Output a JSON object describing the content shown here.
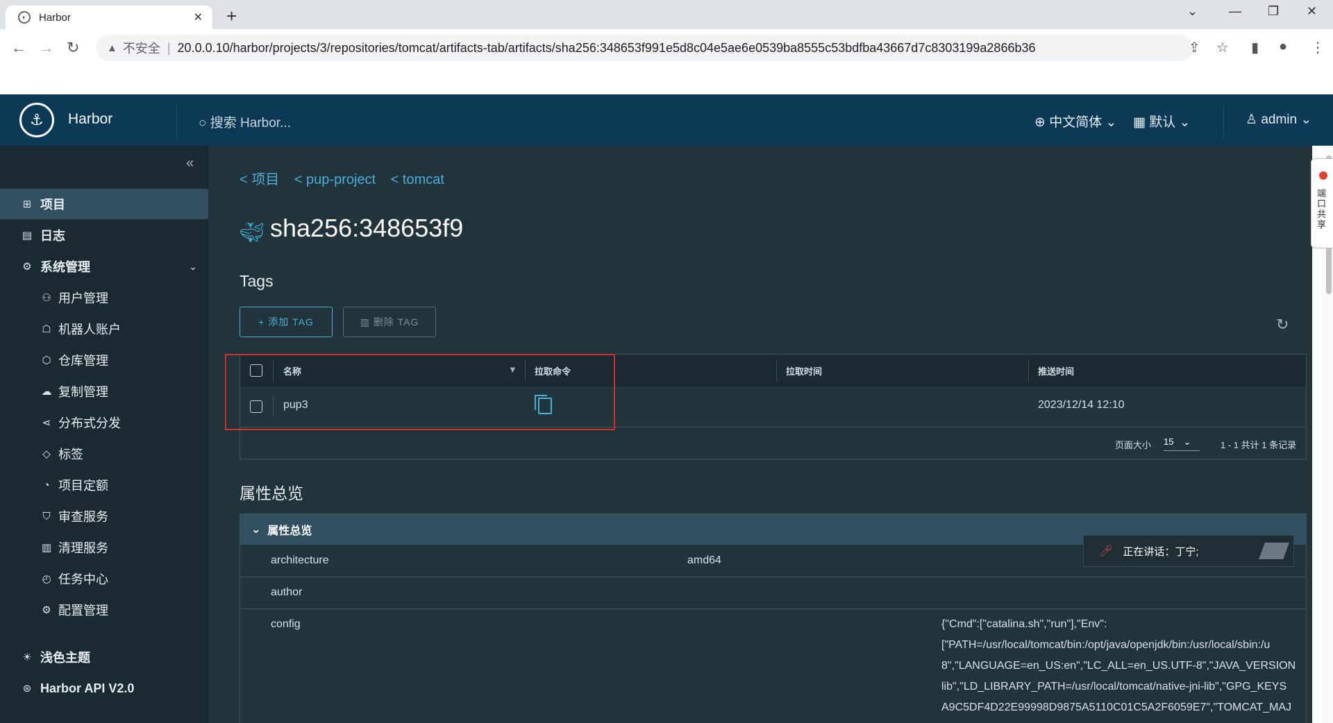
{
  "browser": {
    "tab_title": "Harbor",
    "tab_close": "✕",
    "new_tab": "+",
    "insecure_label": "不安全",
    "url": "20.0.0.10/harbor/projects/3/repositories/tomcat/artifacts-tab/artifacts/sha256:348653f991e5d8c04e5ae6e0539ba8555c53bdfba43667d7c8303199a2866b36"
  },
  "header": {
    "brand": "Harbor",
    "search_placeholder": "搜索 Harbor...",
    "language": "中文简体",
    "theme_default": "默认",
    "user": "admin"
  },
  "sidebar": {
    "items": [
      {
        "label": "项目",
        "icon": "projects-icon"
      },
      {
        "label": "日志",
        "icon": "logs-icon"
      },
      {
        "label": "系统管理",
        "icon": "admin-icon"
      },
      {
        "label": "用户管理",
        "icon": "users-icon"
      },
      {
        "label": "机器人账户",
        "icon": "robot-icon"
      },
      {
        "label": "仓库管理",
        "icon": "registry-icon"
      },
      {
        "label": "复制管理",
        "icon": "replication-icon"
      },
      {
        "label": "分布式分发",
        "icon": "distribution-icon"
      },
      {
        "label": "标签",
        "icon": "tag-icon"
      },
      {
        "label": "项目定额",
        "icon": "quota-icon"
      },
      {
        "label": "审查服务",
        "icon": "shield-icon"
      },
      {
        "label": "清理服务",
        "icon": "trash-icon"
      },
      {
        "label": "任务中心",
        "icon": "gauge-icon"
      },
      {
        "label": "配置管理",
        "icon": "gear-icon"
      }
    ],
    "light_theme": "浅色主题",
    "api": "Harbor API V2.0"
  },
  "breadcrumb": {
    "items": [
      "< 项目",
      "< pup-project",
      "< tomcat"
    ]
  },
  "artifact": {
    "digest": "sha256:348653f9"
  },
  "tags": {
    "heading": "Tags",
    "add_label": "+ 添加 TAG",
    "delete_label": "删除 TAG",
    "columns": [
      "名称",
      "拉取命令",
      "拉取时间",
      "推送时间"
    ],
    "rows": [
      {
        "name": "pup3",
        "pull_time": "",
        "push_time": "2023/12/14 12:10"
      }
    ],
    "page_size_label": "页面大小",
    "page_size": "15",
    "summary": "1 - 1 共计 1 条记录"
  },
  "attributes": {
    "heading": "属性总览",
    "panel_title": "属性总览",
    "rows": [
      {
        "key": "architecture",
        "value": "amd64"
      },
      {
        "key": "author",
        "value": ""
      },
      {
        "key": "config",
        "value": ""
      }
    ],
    "config_lines": [
      "{\"Cmd\":[\"catalina.sh\",\"run\"],\"Env\":",
      "[\"PATH=/usr/local/tomcat/bin:/opt/java/openjdk/bin:/usr/local/sbin:/u",
      "8\",\"LANGUAGE=en_US:en\",\"LC_ALL=en_US.UTF-8\",\"JAVA_VERSION",
      "lib\",\"LD_LIBRARY_PATH=/usr/local/tomcat/native-jni-lib\",\"GPG_KEYS",
      "A9C5DF4D22E99998D9875A5110C01C5A2F6059E7\",\"TOMCAT_MAJ"
    ]
  },
  "toast": {
    "text": "正在讲话：丁宁;"
  },
  "float_panel": {
    "text": "端口共享"
  },
  "colors": {
    "header_bg": "#0b3956",
    "sidebar_bg": "#1b2a32",
    "main_bg": "#21333b",
    "accent": "#4aaed9",
    "highlight_box": "#d1302e"
  }
}
